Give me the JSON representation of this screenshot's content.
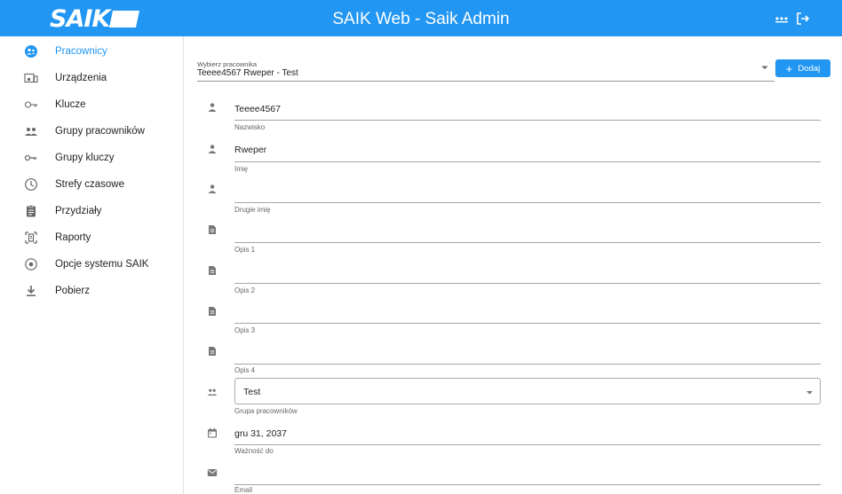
{
  "app": {
    "logo_text": "SAIK",
    "title": "SAIK Web - Saik Admin",
    "brand_color": "#2196f3",
    "icons": {
      "menu": "dots-menu-icon",
      "logout": "logout-icon"
    }
  },
  "sidebar": {
    "items": [
      {
        "label": "Pracownicy",
        "icon": "employees-icon",
        "active": true
      },
      {
        "label": "Urządzenia",
        "icon": "device-icon",
        "active": false
      },
      {
        "label": "Klucze",
        "icon": "key-icon",
        "active": false
      },
      {
        "label": "Grupy pracowników",
        "icon": "people-group-icon",
        "active": false
      },
      {
        "label": "Grupy kluczy",
        "icon": "key-group-icon",
        "active": false
      },
      {
        "label": "Strefy czasowe",
        "icon": "clock-icon",
        "active": false
      },
      {
        "label": "Przydziały",
        "icon": "assignment-icon",
        "active": false
      },
      {
        "label": "Raporty",
        "icon": "report-icon",
        "active": false
      },
      {
        "label": "Opcje systemu SAIK",
        "icon": "radio-settings-icon",
        "active": false
      },
      {
        "label": "Pobierz",
        "icon": "download-icon",
        "active": false
      }
    ]
  },
  "employee_selector": {
    "label": "Wybierz pracownika",
    "value": "Teeee4567 Rweper - Test"
  },
  "add_button": {
    "label": "Dodaj"
  },
  "form": {
    "surname": {
      "value": "Teeee4567",
      "helper": "Nazwisko"
    },
    "first_name": {
      "value": "Rweper",
      "helper": "Imię"
    },
    "second_name": {
      "value": "",
      "helper": "Drugie imię"
    },
    "desc1": {
      "value": "",
      "helper": "Opis 1"
    },
    "desc2": {
      "value": "",
      "helper": "Opis 2"
    },
    "desc3": {
      "value": "",
      "helper": "Opis 3"
    },
    "desc4": {
      "value": "",
      "helper": "Opis 4"
    },
    "group": {
      "value": "Test",
      "helper": "Grupa pracowników"
    },
    "valid_until": {
      "value": "gru 31, 2037",
      "helper": "Ważność do"
    },
    "email": {
      "value": "",
      "helper": "Email"
    }
  }
}
